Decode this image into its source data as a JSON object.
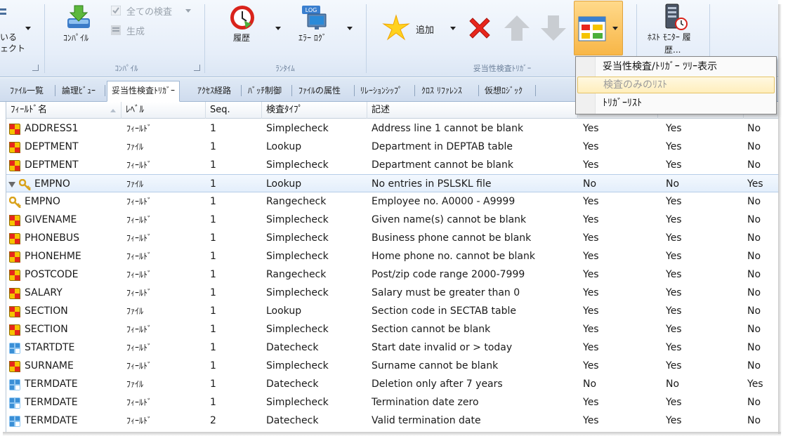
{
  "ribbon": {
    "cut_left_top": "いる",
    "cut_left_bottom": "ェクト",
    "compile_label": "ｺﾝﾊﾟｲﾙ",
    "check_all_label": "全ての検査",
    "generate_label": "生成",
    "group_compile": "ｺﾝﾊﾟｲﾙ",
    "history_label": "履歴",
    "errorlog_label": "ｴﾗｰ ﾛｸﾞ",
    "log_badge": "LOG",
    "group_runtime": "ﾗﾝﾀｲﾑ",
    "add_label": "追加",
    "group_validation": "妥当性検査ﾄﾘｶﾞｰ",
    "host_monitor_label_1": "ﾎｽﾄ ﾓﾆﾀｰ 履",
    "host_monitor_label_2": "歴..."
  },
  "tabs": [
    {
      "label": "ﾌｧｲﾙ一覧",
      "selected": false
    },
    {
      "label": "論理ﾋﾞｭｰ",
      "selected": false
    },
    {
      "label": "妥当性検査ﾄﾘｶﾞｰ",
      "selected": true
    },
    {
      "label": "ｱｸｾｽ経路",
      "selected": false
    },
    {
      "label": "ﾊﾞｯﾁ制御",
      "selected": false
    },
    {
      "label": "ﾌｧｲﾙの属性",
      "selected": false
    },
    {
      "label": "ﾘﾚｰｼｮﾝｼｯﾌﾟ",
      "selected": false
    },
    {
      "label": "ｸﾛｽ ﾘﾌｧﾚﾝｽ",
      "selected": false
    },
    {
      "label": "仮想ﾛｼﾞｯｸ",
      "selected": false
    }
  ],
  "grid": {
    "columns": [
      "ﾌｨｰﾙﾄﾞ名",
      "ﾚﾍﾞﾙ",
      "Seq.",
      "検査ﾀｲﾌﾟ",
      "記述",
      "",
      "",
      ""
    ],
    "rows": [
      {
        "icon": "rule",
        "field": "ADDRESS1",
        "level": "ﾌｨｰﾙﾄﾞ",
        "seq": "1",
        "type": "Simplecheck",
        "desc": "Address line 1 cannot be blank",
        "c1": "Yes",
        "c2": "Yes",
        "c3": "No",
        "selected": false
      },
      {
        "icon": "rule",
        "field": "DEPTMENT",
        "level": "ﾌｧｲﾙ",
        "seq": "1",
        "type": "Lookup",
        "desc": "Department in DEPTAB table",
        "c1": "Yes",
        "c2": "Yes",
        "c3": "No",
        "selected": false
      },
      {
        "icon": "rule",
        "field": "DEPTMENT",
        "level": "ﾌｨｰﾙﾄﾞ",
        "seq": "1",
        "type": "Simplecheck",
        "desc": "Department cannot be blank",
        "c1": "Yes",
        "c2": "Yes",
        "c3": "No",
        "selected": false
      },
      {
        "icon": "key",
        "field": "EMPNO",
        "level": "ﾌｧｲﾙ",
        "seq": "1",
        "type": "Lookup",
        "desc": "No entries in PSLSKL file",
        "c1": "No",
        "c2": "No",
        "c3": "Yes",
        "selected": true
      },
      {
        "icon": "key",
        "field": "EMPNO",
        "level": "ﾌｨｰﾙﾄﾞ",
        "seq": "1",
        "type": "Rangecheck",
        "desc": "Employee no. A0000 - A9999",
        "c1": "Yes",
        "c2": "Yes",
        "c3": "No",
        "selected": false
      },
      {
        "icon": "rule",
        "field": "GIVENAME",
        "level": "ﾌｨｰﾙﾄﾞ",
        "seq": "1",
        "type": "Simplecheck",
        "desc": "Given name(s) cannot be blank",
        "c1": "Yes",
        "c2": "Yes",
        "c3": "No",
        "selected": false
      },
      {
        "icon": "rule",
        "field": "PHONEBUS",
        "level": "ﾌｨｰﾙﾄﾞ",
        "seq": "1",
        "type": "Simplecheck",
        "desc": "Business phone cannot be blank",
        "c1": "Yes",
        "c2": "Yes",
        "c3": "No",
        "selected": false
      },
      {
        "icon": "rule",
        "field": "PHONEHME",
        "level": "ﾌｨｰﾙﾄﾞ",
        "seq": "1",
        "type": "Simplecheck",
        "desc": "Home phone no. cannot be blank",
        "c1": "Yes",
        "c2": "Yes",
        "c3": "No",
        "selected": false
      },
      {
        "icon": "rule",
        "field": "POSTCODE",
        "level": "ﾌｨｰﾙﾄﾞ",
        "seq": "1",
        "type": "Rangecheck",
        "desc": "Post/zip code range 2000-7999",
        "c1": "Yes",
        "c2": "Yes",
        "c3": "No",
        "selected": false
      },
      {
        "icon": "rule",
        "field": "SALARY",
        "level": "ﾌｨｰﾙﾄﾞ",
        "seq": "1",
        "type": "Simplecheck",
        "desc": "Salary must be greater than 0",
        "c1": "Yes",
        "c2": "Yes",
        "c3": "No",
        "selected": false
      },
      {
        "icon": "rule",
        "field": "SECTION",
        "level": "ﾌｧｲﾙ",
        "seq": "1",
        "type": "Lookup",
        "desc": "Section code in SECTAB table",
        "c1": "Yes",
        "c2": "Yes",
        "c3": "No",
        "selected": false
      },
      {
        "icon": "rule",
        "field": "SECTION",
        "level": "ﾌｨｰﾙﾄﾞ",
        "seq": "1",
        "type": "Simplecheck",
        "desc": "Section cannot be blank",
        "c1": "Yes",
        "c2": "Yes",
        "c3": "No",
        "selected": false
      },
      {
        "icon": "date",
        "field": "STARTDTE",
        "level": "ﾌｨｰﾙﾄﾞ",
        "seq": "1",
        "type": "Datecheck",
        "desc": "Start date invalid or > today",
        "c1": "Yes",
        "c2": "Yes",
        "c3": "No",
        "selected": false
      },
      {
        "icon": "rule",
        "field": "SURNAME",
        "level": "ﾌｨｰﾙﾄﾞ",
        "seq": "1",
        "type": "Simplecheck",
        "desc": "Surname cannot be blank",
        "c1": "Yes",
        "c2": "Yes",
        "c3": "No",
        "selected": false
      },
      {
        "icon": "date",
        "field": "TERMDATE",
        "level": "ﾌｧｲﾙ",
        "seq": "1",
        "type": "Datecheck",
        "desc": "Deletion only after 7 years",
        "c1": "No",
        "c2": "No",
        "c3": "Yes",
        "selected": false
      },
      {
        "icon": "date",
        "field": "TERMDATE",
        "level": "ﾌｨｰﾙﾄﾞ",
        "seq": "1",
        "type": "Simplecheck",
        "desc": "Termination date zero",
        "c1": "Yes",
        "c2": "Yes",
        "c3": "No",
        "selected": false
      },
      {
        "icon": "date",
        "field": "TERMDATE",
        "level": "ﾌｨｰﾙﾄﾞ",
        "seq": "2",
        "type": "Datecheck",
        "desc": "Valid termination date",
        "c1": "Yes",
        "c2": "Yes",
        "c3": "No",
        "selected": false
      }
    ]
  },
  "menu": {
    "items": [
      {
        "label": "妥当性検査/ﾄﾘｶﾞｰ ﾂﾘｰ表示",
        "state": "normal"
      },
      {
        "label": "検査のみのﾘｽﾄ",
        "state": "hover-disabled"
      },
      {
        "label": "ﾄﾘｶﾞｰﾘｽﾄ",
        "state": "normal"
      }
    ]
  },
  "colors": {
    "accent_orange": "#f8b647",
    "selection_blue": "#e3eefb",
    "rule_icon_red": "#e8261c",
    "rule_icon_yellow": "#f5c400",
    "date_icon_blue": "#3a8fd6",
    "key_icon_gold": "#d9a21b"
  }
}
